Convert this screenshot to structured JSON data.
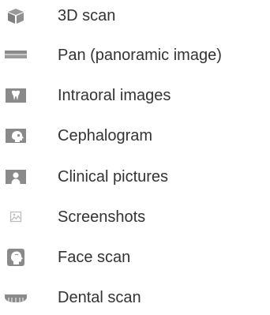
{
  "image_types": {
    "items": [
      {
        "icon": "cube-icon",
        "label": "3D scan"
      },
      {
        "icon": "panoramic-bar-icon",
        "label": "Pan (panoramic image)"
      },
      {
        "icon": "tooth-icon",
        "label": "Intraoral images"
      },
      {
        "icon": "skull-profile-icon",
        "label": "Cephalogram"
      },
      {
        "icon": "person-portrait-icon",
        "label": "Clinical pictures"
      },
      {
        "icon": "image-icon",
        "label": "Screenshots"
      },
      {
        "icon": "face-profile-icon",
        "label": "Face scan"
      },
      {
        "icon": "dental-arch-icon",
        "label": "Dental scan"
      }
    ]
  },
  "colors": {
    "icon_gray": "#8a8a8a",
    "icon_light": "#b8b8b8",
    "text": "#333333"
  }
}
